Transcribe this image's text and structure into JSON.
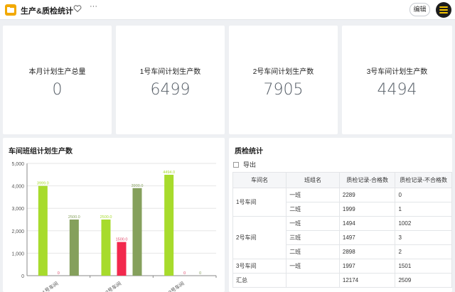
{
  "app": {
    "title": "生产&质检统计",
    "edit_label": "编辑",
    "more": "···"
  },
  "kpis": [
    {
      "label": "本月计划生产总量",
      "value": "0"
    },
    {
      "label": "1号车间计划生产数",
      "value": "6499"
    },
    {
      "label": "2号车间计划生产数",
      "value": "7905"
    },
    {
      "label": "3号车间计划生产数",
      "value": "4494"
    }
  ],
  "chart_panel": {
    "title": "车间班组计划生产数"
  },
  "chart_data": {
    "type": "bar",
    "title": "车间班组计划生产数",
    "categories": [
      "1号车间",
      "2号车间",
      "3号车间"
    ],
    "series": [
      {
        "color": "#a7db2c",
        "values": [
          3999.0,
          2500.0,
          4494.0
        ]
      },
      {
        "color": "#f2294d",
        "values": [
          0,
          1500.0,
          0
        ]
      },
      {
        "color": "#85a05c",
        "values": [
          2500.0,
          3900.0,
          0
        ]
      }
    ],
    "data_labels": [
      [
        "3999.0",
        "0",
        "2500.0"
      ],
      [
        "2500.0",
        "1500.0",
        "3900.0"
      ],
      [
        "4494.0",
        "0",
        "0"
      ]
    ],
    "y_ticks": [
      "0",
      "1,000",
      "2,000",
      "3,000",
      "4,000",
      "5,000"
    ],
    "ylim": [
      0,
      5000
    ],
    "grid": true
  },
  "qc_panel": {
    "title": "质检统计",
    "export_label": "导出",
    "columns": [
      "车间名",
      "班组名",
      "质检记录-合格数",
      "质检记录-不合格数"
    ],
    "rows": [
      {
        "workshop": "1号车间",
        "team": "一班",
        "pass": "2289",
        "fail": "0"
      },
      {
        "workshop": "",
        "team": "二班",
        "pass": "1999",
        "fail": "1"
      },
      {
        "workshop": "2号车间",
        "team": "一班",
        "pass": "1494",
        "fail": "1002"
      },
      {
        "workshop": "",
        "team": "三班",
        "pass": "1497",
        "fail": "3"
      },
      {
        "workshop": "",
        "team": "二班",
        "pass": "2898",
        "fail": "2"
      },
      {
        "workshop": "3号车间",
        "team": "一班",
        "pass": "1997",
        "fail": "1501"
      }
    ],
    "total": {
      "label": "汇总",
      "pass": "12174",
      "fail": "2509"
    }
  }
}
